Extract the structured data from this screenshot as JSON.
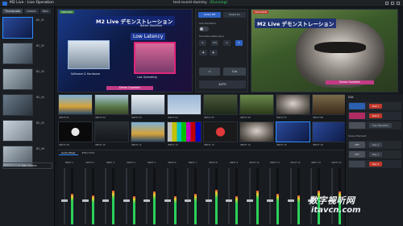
{
  "app": {
    "title": "M2 Live - Live Operation",
    "window_title": "test-event-dummy",
    "status": "(Running)"
  },
  "scenes": {
    "tabs": [
      "Thumbnails",
      "Details",
      "Bars"
    ],
    "items": [
      {
        "label": "B2_01"
      },
      {
        "label": "B2_02"
      },
      {
        "label": "B2_03"
      },
      {
        "label": "B2_04"
      },
      {
        "label": "B2_05"
      },
      {
        "label": "B2_06"
      }
    ],
    "add_label": "+ Add Scene"
  },
  "preview": {
    "label": "PREVIEW",
    "jp_title": "M2 Live デモンストレーション",
    "low_latency": "Low Latency",
    "caption1": "Better Workflow",
    "caption2": "Software & Hardware",
    "caption3": "Low Operating",
    "name_bar": "Demo Goodwin"
  },
  "program": {
    "label": "PROGRAM",
    "jp_title": "M2 Live デモンストレーション",
    "name_bar": "Demo Goodwin"
  },
  "transition": {
    "tabs": [
      "Smart Off",
      "Smart On"
    ],
    "clip_label": "Clip Transition",
    "duration_label": "Transition Rate (Sec)",
    "rates": [
      "0",
      "0.5",
      "1",
      "2"
    ],
    "active_rate_index": 3,
    "cut_label": "Cut",
    "auto_label": "AUTO"
  },
  "inputs": [
    {
      "name": "INPUT 01"
    },
    {
      "name": "INPUT 02"
    },
    {
      "name": "INPUT 03"
    },
    {
      "name": "INPUT 04"
    },
    {
      "name": "INPUT 05"
    },
    {
      "name": "INPUT 06"
    },
    {
      "name": "INPUT 07"
    },
    {
      "name": "INPUT 08"
    },
    {
      "name": "INPUT 09"
    },
    {
      "name": "INPUT 10"
    },
    {
      "name": "INPUT 11"
    },
    {
      "name": "INPUT 12"
    },
    {
      "name": "INPUT 13"
    },
    {
      "name": "INPUT 14"
    },
    {
      "name": "INPUT 15"
    },
    {
      "name": "INPUT 16"
    }
  ],
  "right": {
    "title": "DSK",
    "rows": [
      {
        "thumb": "",
        "pill": "Dsk 1",
        "pill_style": "red"
      },
      {
        "thumb": "",
        "pill": "Dsk 2",
        "pill_style": "red"
      },
      {
        "thumb": "",
        "pill": "Clip Transition",
        "pill_style": "grey"
      }
    ],
    "section2": "Scene Element",
    "rows2": [
      {
        "thumb": "OFF",
        "pill": "Key 1",
        "pill_style": "grey"
      },
      {
        "thumb": "OFF",
        "pill": "Key 2",
        "pill_style": "grey"
      },
      {
        "thumb": "",
        "pill": "Key 3",
        "pill_style": "red"
      }
    ]
  },
  "mixer": {
    "tabs": [
      "Audio Mixer",
      "Effect Edit"
    ],
    "channels": [
      {
        "name": "INPUT 1",
        "fader": 0.45,
        "level": 0.55
      },
      {
        "name": "INPUT 2",
        "fader": 0.45,
        "level": 0.52
      },
      {
        "name": "INPUT 3",
        "fader": 0.45,
        "level": 0.6
      },
      {
        "name": "INPUT 4",
        "fader": 0.45,
        "level": 0.5
      },
      {
        "name": "INPUT 5",
        "fader": 0.45,
        "level": 0.58
      },
      {
        "name": "INPUT 6",
        "fader": 0.45,
        "level": 0.5
      },
      {
        "name": "INPUT 7",
        "fader": 0.45,
        "level": 0.55
      },
      {
        "name": "INPUT 8",
        "fader": 0.45,
        "level": 0.62
      },
      {
        "name": "INPUT 9",
        "fader": 0.45,
        "level": 0.5
      },
      {
        "name": "INPUT 10",
        "fader": 0.45,
        "level": 0.6
      },
      {
        "name": "INPUT 11",
        "fader": 0.45,
        "level": 0.55
      },
      {
        "name": "INPUT 12",
        "fader": 0.45,
        "level": 0.52
      },
      {
        "name": "INPUT 13",
        "fader": 0.45,
        "level": 0.6
      },
      {
        "name": "INPUT 14",
        "fader": 0.45,
        "level": 0.58
      }
    ]
  },
  "watermark": {
    "brand": "数字视听网",
    "url": "itavcn.com"
  },
  "colors": {
    "accent": "#2f8cff",
    "preview_tag": "#3a7d3a",
    "program_tag": "#c0392b",
    "running": "#38d05a"
  }
}
